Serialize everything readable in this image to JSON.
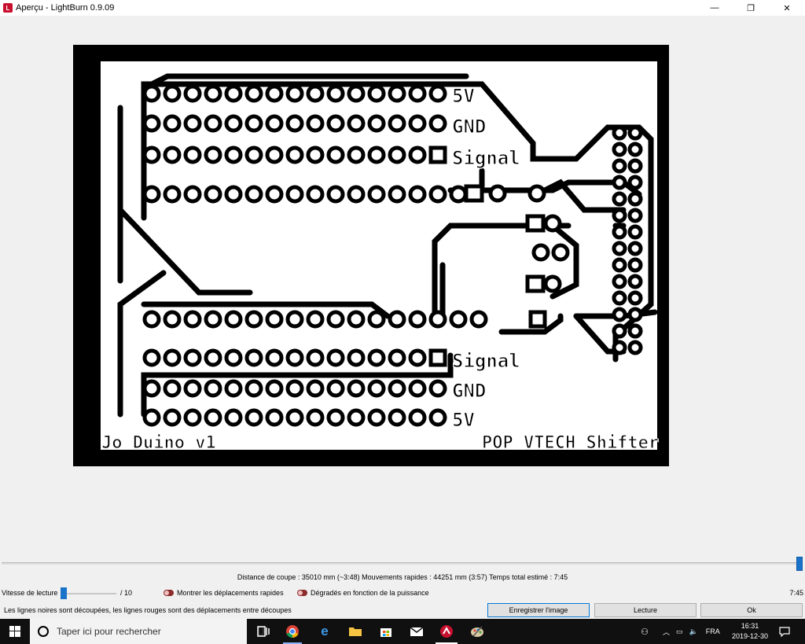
{
  "window": {
    "title": "Aperçu - LightBurn 0.9.09",
    "minimize": "—",
    "restore": "❐",
    "close": "✕"
  },
  "preview": {
    "board_labels": {
      "top_5v": "5V",
      "top_gnd": "GND",
      "top_signal": "Signal",
      "bottom_signal": "Signal",
      "bottom_gnd": "GND",
      "bottom_5v": "5V",
      "left_footer": "Jo Duino v1",
      "right_footer": "POP VTECH Shifter"
    }
  },
  "stats": {
    "text": "Distance de coupe : 35010 mm (~3:48)  Mouvements rapides : 44251 mm (3:57)  Temps total estimé : 7:45"
  },
  "controls": {
    "speed_label": "Vitesse de lecture",
    "speed_max": "/ 10",
    "speed_value": 1,
    "toggle_rapid": "Montrer les déplacements rapides",
    "toggle_gradient": "Dégradés en fonction de la puissance",
    "elapsed": "7:45",
    "progress": 1.0
  },
  "footer": {
    "note": "Les lignes noires sont découpées, les lignes rouges sont des déplacements entre découpes",
    "save_button": "Enregistrer l'image",
    "play_button": "Lecture",
    "ok_button": "Ok"
  },
  "taskbar": {
    "search_placeholder": "Taper ici pour rechercher",
    "language": "FRA",
    "time": "16:31",
    "date": "2019-12-30"
  },
  "colors": {
    "accent": "#0078d7",
    "slider": "#1a73c8",
    "toggle": "#8b2b2b",
    "app_icon": "#c8102e"
  }
}
